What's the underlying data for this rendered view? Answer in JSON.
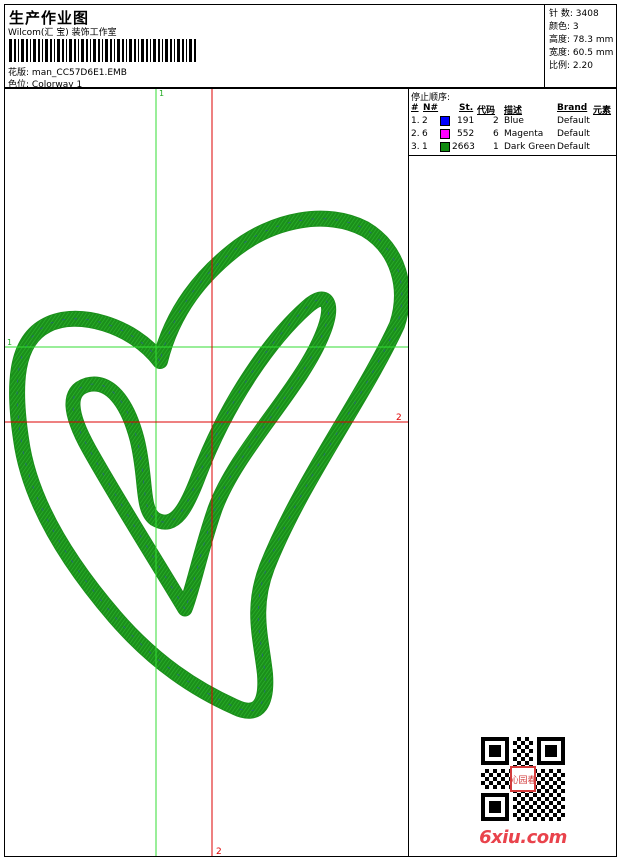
{
  "header": {
    "title": "生产作业图",
    "company": "Wilcom(汇 宝) 装饰工作室",
    "design_label": "花版:",
    "design_value": "man_CC57D6E1.EMB",
    "colorway_label": "色位:",
    "colorway_value": "Colorway 1"
  },
  "stats": [
    {
      "label": "针 数:",
      "value": "3408"
    },
    {
      "label": "颜色:",
      "value": "3"
    },
    {
      "label": "高度:",
      "value": "78.3 mm"
    },
    {
      "label": "宽度:",
      "value": "60.5 mm"
    },
    {
      "label": "比例:",
      "value": "2.20"
    }
  ],
  "stops": {
    "title": "停止顺序:",
    "headers": {
      "num": "#",
      "n": "N#",
      "st": "St.",
      "code": "代码",
      "desc": "描述",
      "brand": "Brand",
      "elem": "元素"
    },
    "rows": [
      {
        "num": "1.",
        "n": "2",
        "color": "#0000ff",
        "st": "191",
        "code": "2",
        "desc": "Blue",
        "brand": "Default"
      },
      {
        "num": "2.",
        "n": "6",
        "color": "#ff00ff",
        "st": "552",
        "code": "6",
        "desc": "Magenta",
        "brand": "Default"
      },
      {
        "num": "3.",
        "n": "1",
        "color": "#108a10",
        "st": "2663",
        "code": "1",
        "desc": "Dark Green",
        "brand": "Default"
      }
    ]
  },
  "guides": {
    "green_v_label": "1",
    "green_h_label": "1",
    "red_h_label": "2",
    "red_v_label": "2",
    "green_color": "#33dd33",
    "red_color": "#dd0000"
  },
  "design_colors": {
    "stitch": "#1a8f1a",
    "stitch_light": "#2fb52f",
    "underlay": "#3344cc"
  },
  "watermark": {
    "brand": "6xiu.com",
    "seal": "沁园春"
  }
}
